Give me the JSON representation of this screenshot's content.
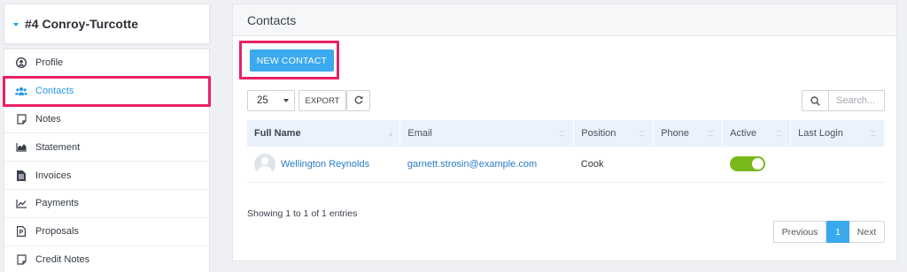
{
  "client": {
    "title": "#4 Conroy-Turcotte"
  },
  "sidebar": {
    "items": [
      {
        "label": "Profile",
        "icon": "user-circle-icon"
      },
      {
        "label": "Contacts",
        "icon": "users-icon",
        "active": true
      },
      {
        "label": "Notes",
        "icon": "note-icon"
      },
      {
        "label": "Statement",
        "icon": "area-chart-icon"
      },
      {
        "label": "Invoices",
        "icon": "file-text-icon"
      },
      {
        "label": "Payments",
        "icon": "line-chart-icon"
      },
      {
        "label": "Proposals",
        "icon": "file-proposal-icon"
      },
      {
        "label": "Credit Notes",
        "icon": "note-icon"
      }
    ]
  },
  "panel": {
    "title": "Contacts",
    "new_contact_label": "NEW CONTACT",
    "page_size": "25",
    "export_label": "EXPORT",
    "search_placeholder": "Search...",
    "columns": [
      "Full Name",
      "Email",
      "Position",
      "Phone",
      "Active",
      "Last Login"
    ],
    "rows": [
      {
        "full_name": "Wellington Reynolds",
        "email": "garnett.strosin@example.com",
        "position": "Cook",
        "phone": "",
        "active": true,
        "last_login": ""
      }
    ],
    "info": "Showing 1 to 1 of 1 entries",
    "pagination": {
      "previous": "Previous",
      "current": "1",
      "next": "Next"
    }
  },
  "colors": {
    "accent": "#3ba9ee",
    "highlight": "#ea2067",
    "toggle_on": "#79b81b",
    "link": "#2a7cc7"
  }
}
